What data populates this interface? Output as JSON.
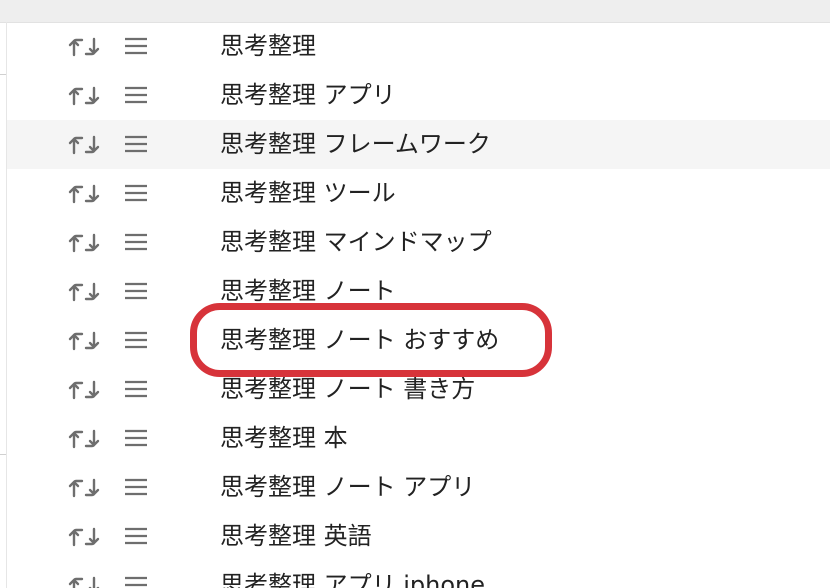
{
  "suggestions": [
    {
      "keyword": "思考整理"
    },
    {
      "keyword": "思考整理 アプリ"
    },
    {
      "keyword": "思考整理 フレームワーク"
    },
    {
      "keyword": "思考整理 ツール"
    },
    {
      "keyword": "思考整理 マインドマップ"
    },
    {
      "keyword": "思考整理 ノート"
    },
    {
      "keyword": "思考整理 ノート おすすめ"
    },
    {
      "keyword": "思考整理 ノート 書き方"
    },
    {
      "keyword": "思考整理 本"
    },
    {
      "keyword": "思考整理 ノート アプリ"
    },
    {
      "keyword": "思考整理 英語"
    },
    {
      "keyword": "思考整理 アプリ iphone"
    }
  ],
  "hovered_row_index": 2,
  "highlighted_row_index": 6,
  "icons": {
    "action_1": "retweet-icon",
    "action_2": "menu-icon"
  },
  "colors": {
    "text": "#222222",
    "icon": "#6e6e6e",
    "hover_row": "#f5f5f5",
    "highlight_ring": "#d7333a",
    "top_band": "#eeeeee"
  }
}
